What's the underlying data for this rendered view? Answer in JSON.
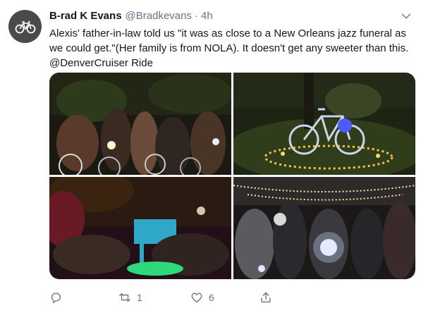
{
  "tweet": {
    "author_name": "B-rad K Evans",
    "author_handle": "@Bradkevans",
    "separator": "·",
    "time": "4h",
    "text": "Alexis' father-in-law told us \"it was as close to a New Orleans jazz funeral as we could get.\"(Her family is from NOLA). It doesn't get any sweeter than this. @DenverCruiser Ride",
    "retweet_count": "1",
    "like_count": "6"
  },
  "icons": {
    "avatar": "bicycle-avatar",
    "menu": "chevron-down-icon",
    "reply": "reply-icon",
    "retweet": "retweet-icon",
    "like": "heart-icon",
    "share": "share-icon"
  },
  "colors": {
    "text_primary": "#14171a",
    "text_secondary": "#657786"
  }
}
